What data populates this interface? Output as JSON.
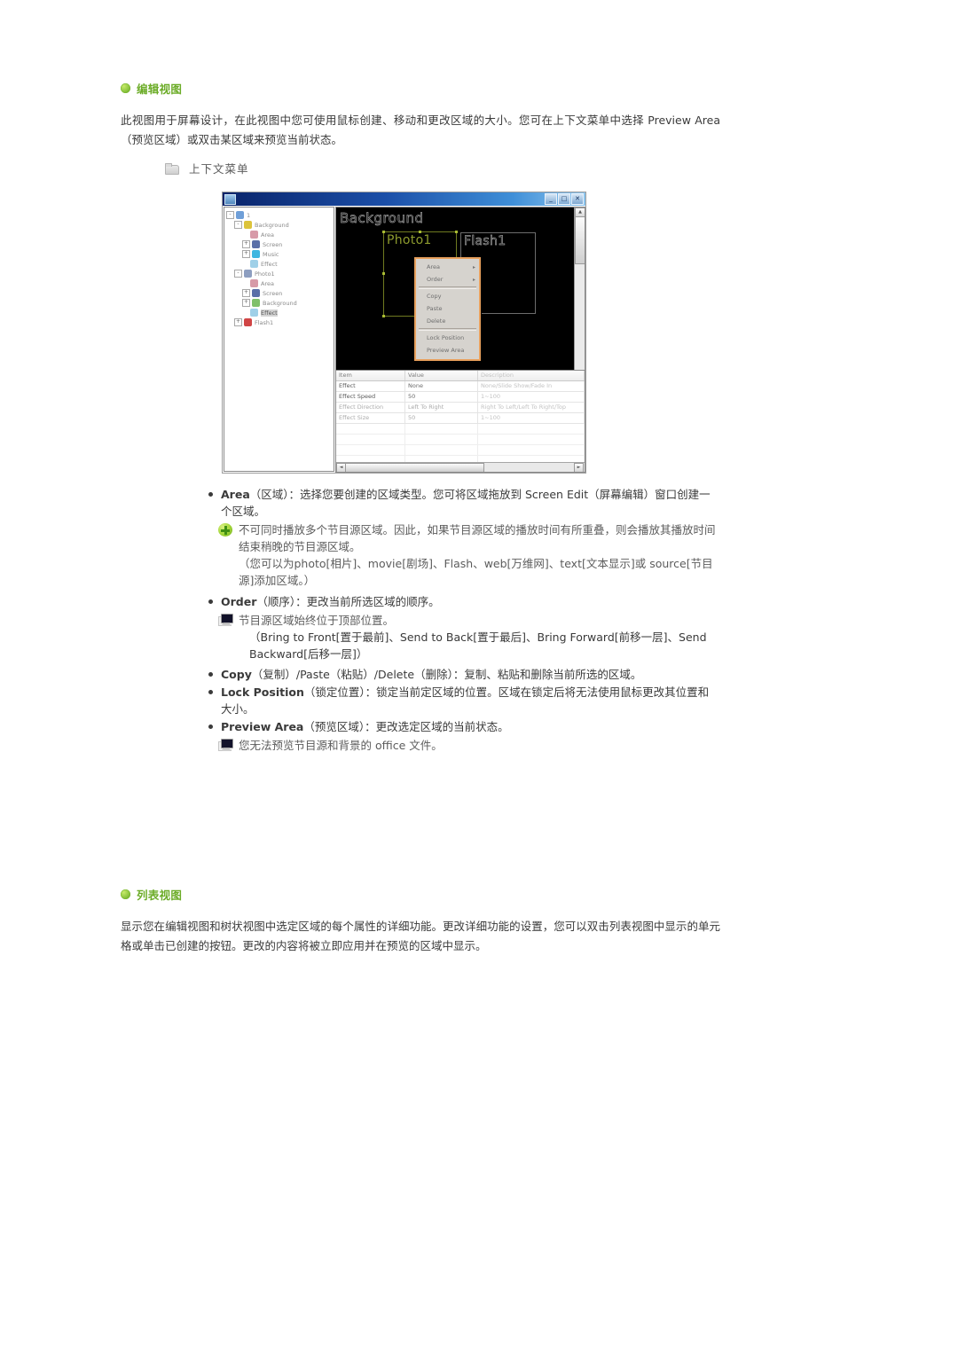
{
  "sections": {
    "edit_view": {
      "title": "编辑视图",
      "paragraph": "此视图用于屏幕设计，在此视图中您可使用鼠标创建、移动和更改区域的大小。您可在上下文菜单中选择 Preview Area（预览区域）或双击某区域来预览当前状态。",
      "subheading": "上下文菜单"
    },
    "list_view": {
      "title": "列表视图",
      "paragraph": "显示您在编辑视图和树状视图中选定区域的每个属性的详细功能。更改详细功能的设置，您可以双击列表视图中显示的单元格或单击已创建的按钮。更改的内容将被立即应用并在预览的区域中显示。"
    }
  },
  "bullets": {
    "area": {
      "term": "Area",
      "text": "（区域）：选择您要创建的区域类型。您可将区域拖放到 Screen Edit（屏幕编辑）窗口创建一个区域。",
      "note": "不可同时播放多个节目源区域。因此，如果节目源区域的播放时间有所重叠，则会播放其播放时间结束稍晚的节目源区域。",
      "subnote": "（您可以为photo[相片]、movie[剧场]、Flash、web[万维网]、text[文本显示]或 source[节目源]添加区域。）"
    },
    "order": {
      "term": "Order",
      "text": "（顺序）：更改当前所选区域的顺序。",
      "note": "节目源区域始终位于顶部位置。",
      "subnote": "（Bring to Front[置于最前]、Send to Back[置于最后]、Bring Forward[前移一层]、Send Backward[后移一层]）"
    },
    "copy": {
      "term": "Copy",
      "text": "（复制）/Paste（粘贴）/Delete（删除）：复制、粘贴和删除当前所选的区域。"
    },
    "lock": {
      "term": "Lock Position",
      "text": "（锁定位置）：锁定当前定区域的位置。区域在锁定后将无法使用鼠标更改其位置和大小。"
    },
    "preview": {
      "term": "Preview Area",
      "text": "（预览区域）：更改选定区域的当前状态。",
      "note": "您无法预览节目源和背景的 office 文件。"
    }
  },
  "appshot": {
    "window_buttons": [
      "_",
      "□",
      "✕"
    ],
    "tree": [
      {
        "label": "1",
        "depth": 0,
        "expander": "-",
        "icon": "root-icon",
        "color": "#6f9fd8",
        "selected": false
      },
      {
        "label": "Background",
        "depth": 1,
        "expander": "-",
        "icon": "background-icon",
        "color": "#dcc33a",
        "selected": false
      },
      {
        "label": "Area",
        "depth": 2,
        "expander": "",
        "icon": "area-icon",
        "color": "#d79aa8",
        "selected": false
      },
      {
        "label": "Screen",
        "depth": 2,
        "expander": "+",
        "icon": "screen-icon",
        "color": "#5a6fa8",
        "selected": false
      },
      {
        "label": "Music",
        "depth": 2,
        "expander": "+",
        "icon": "music-icon",
        "color": "#3eb6e0",
        "selected": false
      },
      {
        "label": "Effect",
        "depth": 2,
        "expander": "",
        "icon": "effect-icon",
        "color": "#9fd0e8",
        "selected": false
      },
      {
        "label": "Photo1",
        "depth": 1,
        "expander": "-",
        "icon": "photo-icon",
        "color": "#8d9ec0",
        "selected": false
      },
      {
        "label": "Area",
        "depth": 2,
        "expander": "",
        "icon": "area-icon",
        "color": "#d79aa8",
        "selected": false
      },
      {
        "label": "Screen",
        "depth": 2,
        "expander": "+",
        "icon": "screen-icon",
        "color": "#5a6fa8",
        "selected": false
      },
      {
        "label": "Background",
        "depth": 2,
        "expander": "+",
        "icon": "background-icon",
        "color": "#7fc06a",
        "selected": false
      },
      {
        "label": "Effect",
        "depth": 2,
        "expander": "",
        "icon": "effect-icon",
        "color": "#9fd0e8",
        "selected": true
      },
      {
        "label": "Flash1",
        "depth": 1,
        "expander": "+",
        "icon": "flash-icon",
        "color": "#d04545",
        "selected": false
      }
    ],
    "canvas": {
      "background_label": "Background",
      "areas": [
        {
          "name": "Photo1",
          "selected": true
        },
        {
          "name": "Flash1",
          "selected": false
        }
      ]
    },
    "context_menu": [
      {
        "label": "Area",
        "submenu": "▸"
      },
      {
        "label": "Order",
        "submenu": "▸"
      },
      {
        "label": "Copy",
        "submenu": ""
      },
      {
        "label": "Paste",
        "submenu": ""
      },
      {
        "label": "Delete",
        "submenu": ""
      },
      {
        "label": "Lock Position",
        "submenu": ""
      },
      {
        "label": "Preview Area",
        "submenu": ""
      }
    ],
    "listview": {
      "columns": [
        "Item",
        "Value",
        "Description"
      ],
      "rows": [
        {
          "item": "Effect",
          "value": "None",
          "description": "None/Slide Show/Fade In",
          "dim": false
        },
        {
          "item": "Effect Speed",
          "value": "50",
          "description": "1~100",
          "dim": false
        },
        {
          "item": "Effect Direction",
          "value": "Left To Right",
          "description": "Right To Left/Left To Right/Top",
          "dim": true
        },
        {
          "item": "Effect Size",
          "value": "50",
          "description": "1~100",
          "dim": true
        }
      ]
    }
  }
}
